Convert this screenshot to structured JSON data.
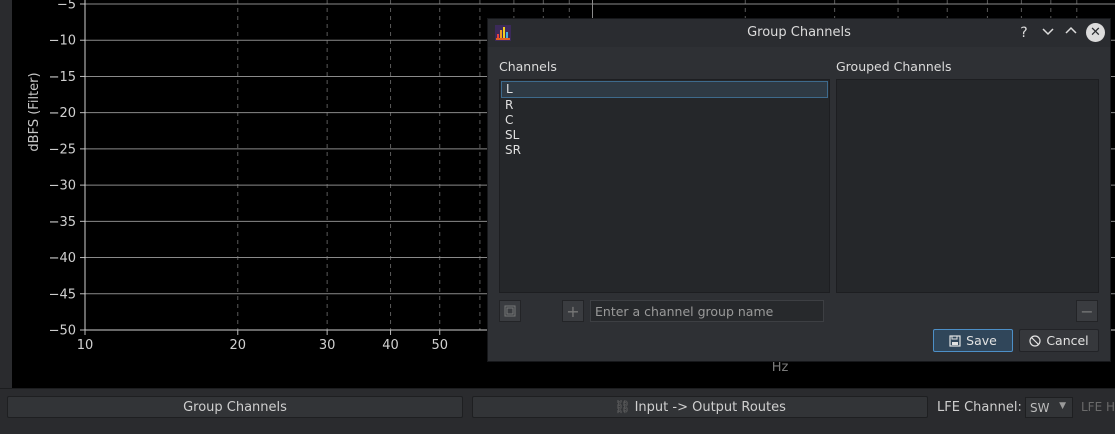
{
  "chart_data": {
    "type": "line",
    "title": "",
    "ylabel": "dBFS (Filter)",
    "xlabel": "Hz",
    "x_scale": "log",
    "xlim": [
      10,
      1000
    ],
    "ylim": [
      -50,
      -5
    ],
    "yticks": [
      -5,
      -10,
      -15,
      -20,
      -25,
      -30,
      -35,
      -40,
      -45,
      -50
    ],
    "xticks": [
      10,
      20,
      30,
      40,
      50
    ],
    "grid": true,
    "series": []
  },
  "bottom": {
    "group_channels_label": "Group Channels",
    "routes_label": "Input -> Output Routes",
    "lfe_label": "LFE Channel:",
    "lfe_value": "SW",
    "lfe_h_label": "LFE H"
  },
  "dialog": {
    "title": "Group Channels",
    "help": "?",
    "minimize": "⌄",
    "maximize": "⌃",
    "close": "✕",
    "channels_label": "Channels",
    "grouped_label": "Grouped Channels",
    "channels": [
      "L",
      "R",
      "C",
      "SL",
      "SR"
    ],
    "selected_channel": "L",
    "group_name_placeholder": "Enter a channel group name",
    "save_label": "Save",
    "cancel_label": "Cancel"
  },
  "colors": {
    "plot_bg": "#000000",
    "grid": "#7a7a7a",
    "accent": "#4d8fc7"
  }
}
